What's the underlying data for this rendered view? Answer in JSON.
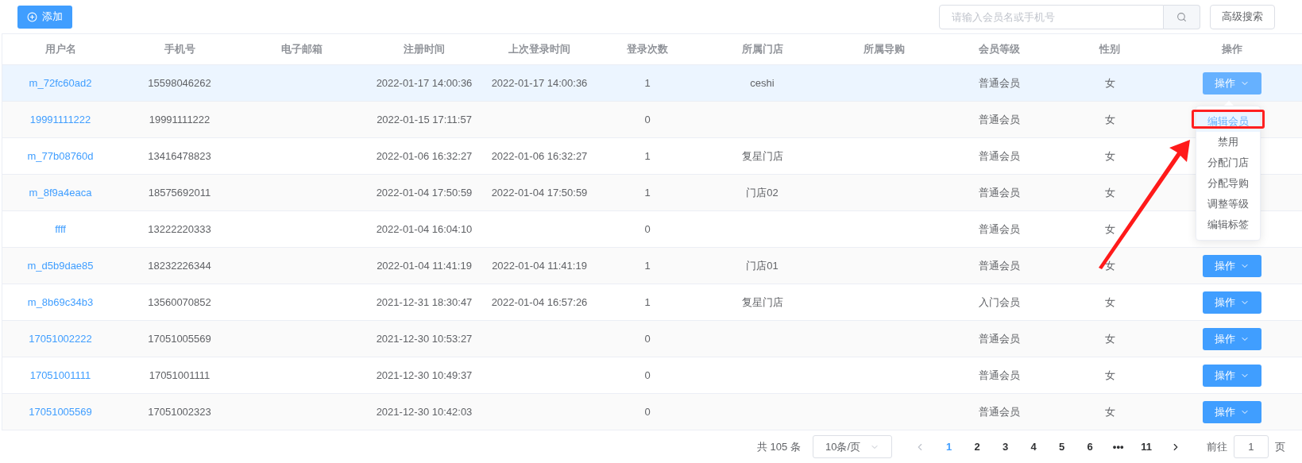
{
  "toolbar": {
    "add_button": "添加",
    "search": {
      "placeholder": "请输入会员名或手机号"
    },
    "advanced_search_button": "高级搜索"
  },
  "table": {
    "columns": [
      "用户名",
      "手机号",
      "电子邮箱",
      "注册时间",
      "上次登录时间",
      "登录次数",
      "所属门店",
      "所属导购",
      "会员等级",
      "性别",
      "操作"
    ],
    "rows": [
      {
        "highlighted": true,
        "cells": [
          "m_72fc60ad2",
          "15598046262",
          "",
          "2022-01-17 14:00:36",
          "2022-01-17 14:00:36",
          "1",
          "ceshi",
          "",
          "普通会员",
          "女"
        ],
        "action": "操作"
      },
      {
        "highlighted": false,
        "cells": [
          "19991111222",
          "19991111222",
          "",
          "2022-01-15 17:11:57",
          "",
          "0",
          "",
          "",
          "普通会员",
          "女"
        ]
      },
      {
        "highlighted": false,
        "cells": [
          "m_77b08760d",
          "13416478823",
          "",
          "2022-01-06 16:32:27",
          "2022-01-06 16:32:27",
          "1",
          "复星门店",
          "",
          "普通会员",
          "女"
        ]
      },
      {
        "highlighted": false,
        "cells": [
          "m_8f9a4eaca",
          "18575692011",
          "",
          "2022-01-04 17:50:59",
          "2022-01-04 17:50:59",
          "1",
          "门店02",
          "",
          "普通会员",
          "女"
        ]
      },
      {
        "highlighted": false,
        "cells": [
          "ffff",
          "13222220333",
          "",
          "2022-01-04 16:04:10",
          "",
          "0",
          "",
          "",
          "普通会员",
          "女"
        ]
      },
      {
        "highlighted": false,
        "cells": [
          "m_d5b9dae85",
          "18232226344",
          "",
          "2022-01-04 11:41:19",
          "2022-01-04 11:41:19",
          "1",
          "门店01",
          "",
          "普通会员",
          "女"
        ],
        "action": "操作"
      },
      {
        "highlighted": false,
        "cells": [
          "m_8b69c34b3",
          "13560070852",
          "",
          "2021-12-31 18:30:47",
          "2022-01-04 16:57:26",
          "1",
          "复星门店",
          "",
          "入门会员",
          "女"
        ],
        "action": "操作"
      },
      {
        "highlighted": false,
        "cells": [
          "17051002222",
          "17051005569",
          "",
          "2021-12-30 10:53:27",
          "",
          "0",
          "",
          "",
          "普通会员",
          "女"
        ],
        "action": "操作"
      },
      {
        "highlighted": false,
        "cells": [
          "17051001111",
          "17051001111",
          "",
          "2021-12-30 10:49:37",
          "",
          "0",
          "",
          "",
          "普通会员",
          "女"
        ],
        "action": "操作"
      },
      {
        "highlighted": false,
        "cells": [
          "17051005569",
          "17051002323",
          "",
          "2021-12-30 10:42:03",
          "",
          "0",
          "",
          "",
          "普通会员",
          "女"
        ],
        "action": "操作"
      }
    ]
  },
  "dropdown_menu": {
    "items": [
      {
        "label": "编辑会员",
        "selected": true
      },
      {
        "label": "禁用",
        "selected": false
      },
      {
        "label": "分配门店",
        "selected": false
      },
      {
        "label": "分配导购",
        "selected": false
      },
      {
        "label": "调整等级",
        "selected": false
      },
      {
        "label": "编辑标签",
        "selected": false
      }
    ]
  },
  "pagination": {
    "total": "共 105 条",
    "page_size": "10条/页",
    "pages": [
      {
        "label": "1",
        "selected": true
      },
      {
        "label": "2",
        "selected": false
      },
      {
        "label": "3",
        "selected": false
      },
      {
        "label": "4",
        "selected": false
      },
      {
        "label": "5",
        "selected": false
      },
      {
        "label": "6",
        "selected": false
      },
      {
        "label": "•••",
        "selected": false
      },
      {
        "label": "11",
        "selected": false
      }
    ],
    "goto_label": "前往",
    "goto_value": "1",
    "goto_suffix": "页"
  }
}
